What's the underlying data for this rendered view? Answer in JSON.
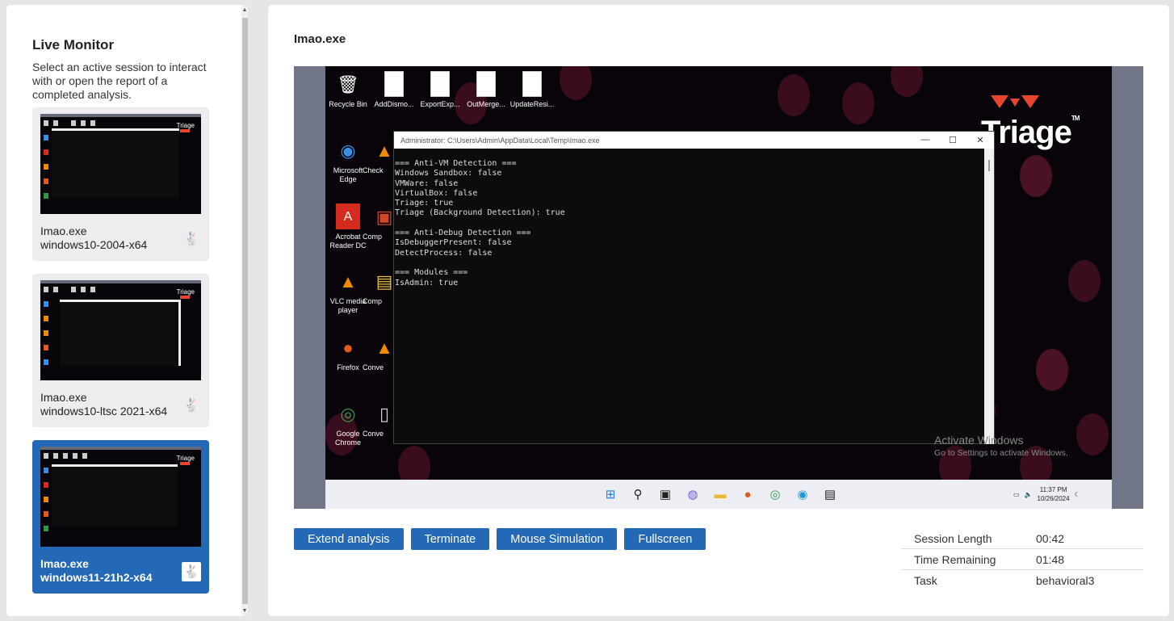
{
  "sidebar": {
    "title": "Live Monitor",
    "description": "Select an active session to interact with or open the report of a completed analysis.",
    "sessions": [
      {
        "file": "Imao.exe",
        "profile": "windows10-2004-x64",
        "active": false
      },
      {
        "file": "Imao.exe",
        "profile": "windows10-ltsc 2021-x64",
        "active": false
      },
      {
        "file": "Imao.exe",
        "profile": "windows11-21h2-x64",
        "active": true
      }
    ]
  },
  "main": {
    "title": "Imao.exe",
    "desktop": {
      "icons_top": [
        "Recycle Bin",
        "AddDismo...",
        "ExportExp...",
        "OutMerge...",
        "UpdateResi..."
      ],
      "icons_left": [
        "Microsoft Edge",
        "Acrobat Reader DC",
        "VLC media player",
        "Firefox",
        "Google Chrome"
      ],
      "icons_second": [
        "Check",
        "Comp",
        "Comp",
        "Conve",
        "Conve"
      ],
      "window_title": "Administrator: C:\\Users\\Admin\\AppData\\Local\\Temp\\Imao.exe",
      "console_output": "=== Anti-VM Detection ===\nWindows Sandbox: false\nVMWare: false\nVirtualBox: false\nTriage: true\nTriage (Background Detection): true\n\n=== Anti-Debug Detection ===\nIsDebuggerPresent: false\nDetectProcess: false\n\n=== Modules ===\nIsAdmin: true",
      "logo_text": "Triage",
      "activate_title": "Activate Windows",
      "activate_sub": "Go to Settings to activate Windows.",
      "clock_time": "11:37 PM",
      "clock_date": "10/26/2024"
    },
    "buttons": {
      "extend": "Extend analysis",
      "terminate": "Terminate",
      "mouse": "Mouse Simulation",
      "fullscreen": "Fullscreen"
    },
    "stats": [
      {
        "label": "Session Length",
        "value": "00:42"
      },
      {
        "label": "Time Remaining",
        "value": "01:48"
      },
      {
        "label": "Task",
        "value": "behavioral3"
      }
    ]
  }
}
